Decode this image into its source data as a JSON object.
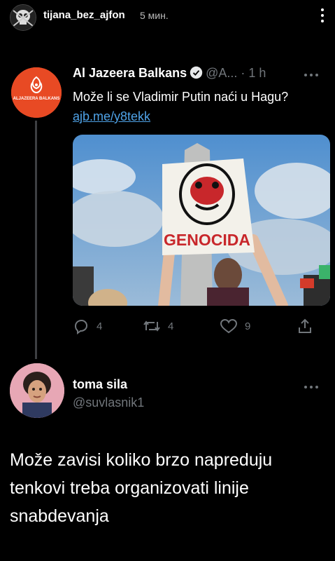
{
  "story": {
    "username": "tijana_bez_ajfon",
    "time": "5 мин."
  },
  "tweet1": {
    "display_name": "Al Jazeera Balkans",
    "handle": "@A...",
    "separator": "·",
    "time": "1 h",
    "text": "Može li se Vladimir Putin naći u Hagu?",
    "link": "ajb.me/y8tekk",
    "avatar_logo_text": "ALJAZEERA BALKANS",
    "media_sign_text": "GENOCIDA",
    "actions": {
      "reply_count": "4",
      "retweet_count": "4",
      "like_count": "9"
    }
  },
  "tweet2": {
    "display_name": "toma sila",
    "handle": "@suvlasnik1",
    "text": "Može zavisi koliko brzo napreduju tenkovi treba organizovati linije snabdevanja"
  },
  "colors": {
    "background": "#000000",
    "link": "#4fa3e8",
    "muted": "#71767b",
    "aljazeera_orange": "#e84a24"
  }
}
